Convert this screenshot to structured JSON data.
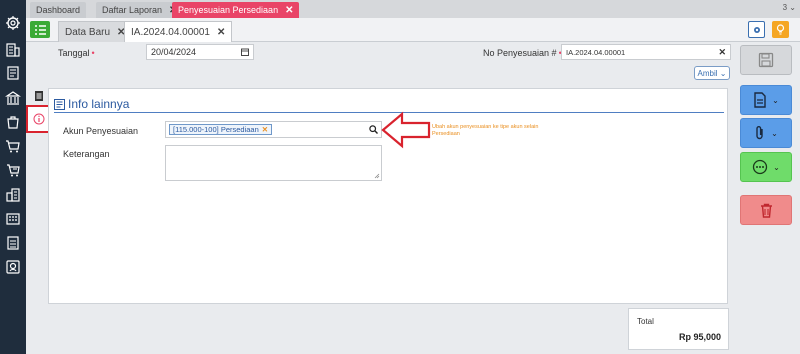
{
  "sidebar": {
    "icons": [
      "settings-icon",
      "building-icon",
      "document-icon",
      "bank-icon",
      "inventory-icon",
      "cart-icon",
      "purchase-icon",
      "warehouse-icon",
      "calculator-icon",
      "report-icon",
      "badge-icon"
    ]
  },
  "top_tabs": [
    {
      "label": "Dashboard",
      "closable": false
    },
    {
      "label": "Daftar Laporan",
      "closable": true
    },
    {
      "label": "Penyesuaian Persediaan",
      "closable": true,
      "active": true
    }
  ],
  "top_count": "3",
  "sub_tabs": [
    {
      "label": "Data Baru",
      "closable": true
    },
    {
      "label": "IA.2024.04.00001",
      "closable": true,
      "active": true
    }
  ],
  "form": {
    "tanggal_label": "Tanggal",
    "tanggal_value": "20/04/2024",
    "nopenyesuaian_label": "No Penyesuaian #",
    "nopenyesuaian_value": "IA.2024.04.00001",
    "ambil_label": "Ambil"
  },
  "panel": {
    "title": "Info lainnya",
    "akun_label": "Akun Penyesuaian",
    "akun_chip": "[115.000-100] Persediaan",
    "keterangan_label": "Keterangan"
  },
  "annotation": {
    "text": "Ubah akun penyesuaian ke tipe akun selain Persediaan",
    "color": "#e98e1f",
    "arrow_color": "#d9232e"
  },
  "total": {
    "label": "Total",
    "value": "Rp 95,000"
  },
  "colors": {
    "sidebar": "#1f2d3d",
    "active_tab": "#e94467",
    "accent_blue": "#5b9de8",
    "accent_green": "#6fdc6a",
    "accent_red": "#f08b8b"
  }
}
